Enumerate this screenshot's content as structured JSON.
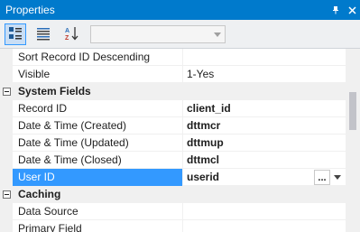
{
  "window": {
    "title": "Properties",
    "pin_icon": "pin-icon",
    "close_icon": "close-icon"
  },
  "toolbar": {
    "categorized_icon": "categorized-icon",
    "property_pages_icon": "property-pages-icon",
    "alphabetical_icon": "alphabetical-icon",
    "object_selector_value": ""
  },
  "grid": {
    "rows": [
      {
        "name": "Sort Record ID Descending",
        "value": ""
      },
      {
        "name": "Visible",
        "value": "1-Yes"
      }
    ],
    "system_fields": {
      "title": "System Fields",
      "rows": [
        {
          "name": "Record ID",
          "value": "client_id"
        },
        {
          "name": "Date & Time (Created)",
          "value": "dttmcr"
        },
        {
          "name": "Date & Time (Updated)",
          "value": "dttmup"
        },
        {
          "name": "Date & Time (Closed)",
          "value": "dttmcl"
        },
        {
          "name": "User ID",
          "value": "userid",
          "ellipsis": "..."
        }
      ]
    },
    "caching": {
      "title": "Caching",
      "rows": [
        {
          "name": "Data Source",
          "value": ""
        },
        {
          "name": "Primary Field",
          "value": ""
        }
      ]
    }
  },
  "colors": {
    "titlebar": "#007acc",
    "selection": "#3399ff"
  }
}
